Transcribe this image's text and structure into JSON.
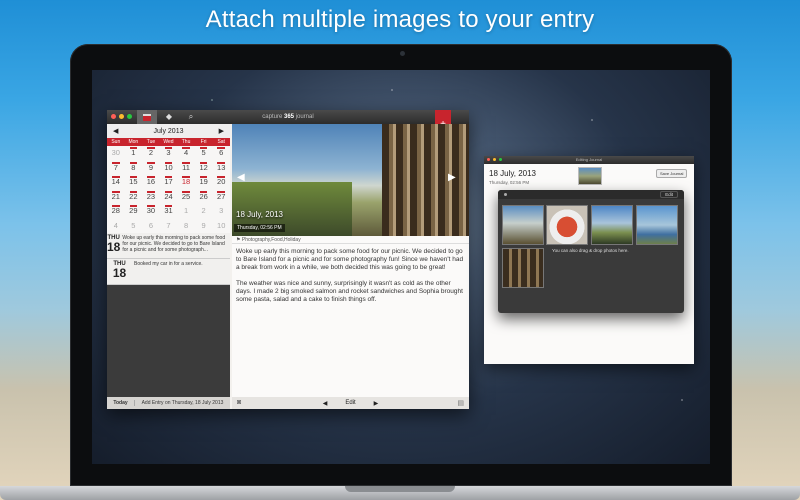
{
  "headline": "Attach multiple images to your entry",
  "main_window": {
    "title_prefix": "capture",
    "title_bold": "365",
    "title_suffix": "journal",
    "toolbar": {
      "calendar_icon": "calendar-icon",
      "tag_icon": "tag-icon",
      "search_icon": "search-icon"
    },
    "ribbon_symbol": "+",
    "calendar": {
      "prev": "◀",
      "next": "▶",
      "month": "July 2013",
      "weekdays": [
        "Sun",
        "Mon",
        "Tue",
        "Wed",
        "Thu",
        "Fri",
        "Sat"
      ],
      "days": [
        {
          "n": "30",
          "dim": true
        },
        {
          "n": "1"
        },
        {
          "n": "2"
        },
        {
          "n": "3"
        },
        {
          "n": "4"
        },
        {
          "n": "5"
        },
        {
          "n": "6"
        },
        {
          "n": "7"
        },
        {
          "n": "8"
        },
        {
          "n": "9"
        },
        {
          "n": "10"
        },
        {
          "n": "11"
        },
        {
          "n": "12"
        },
        {
          "n": "13"
        },
        {
          "n": "14"
        },
        {
          "n": "15"
        },
        {
          "n": "16"
        },
        {
          "n": "17"
        },
        {
          "n": "18",
          "red": true
        },
        {
          "n": "19"
        },
        {
          "n": "20"
        },
        {
          "n": "21"
        },
        {
          "n": "22"
        },
        {
          "n": "23"
        },
        {
          "n": "24"
        },
        {
          "n": "25"
        },
        {
          "n": "26"
        },
        {
          "n": "27"
        },
        {
          "n": "28"
        },
        {
          "n": "29"
        },
        {
          "n": "30"
        },
        {
          "n": "31"
        },
        {
          "n": "1",
          "dim": true
        },
        {
          "n": "2",
          "dim": true
        },
        {
          "n": "3",
          "dim": true
        },
        {
          "n": "4",
          "dim": true
        },
        {
          "n": "5",
          "dim": true
        },
        {
          "n": "6",
          "dim": true
        },
        {
          "n": "7",
          "dim": true
        },
        {
          "n": "8",
          "dim": true
        },
        {
          "n": "9",
          "dim": true
        },
        {
          "n": "10",
          "dim": true
        }
      ],
      "marked": [
        "1",
        "2",
        "3",
        "4",
        "5",
        "6",
        "7",
        "8",
        "9",
        "10",
        "11",
        "12",
        "13",
        "14",
        "15",
        "16",
        "17",
        "18",
        "19",
        "20",
        "21",
        "22",
        "23",
        "24",
        "25",
        "26",
        "27",
        "28",
        "29",
        "30",
        "31"
      ]
    },
    "entries": [
      {
        "day": "THU",
        "date": "18",
        "text": "Woke up early this morning to pack some food for our picnic. We decided to go to Bare Island for a picnic and for some photograph..."
      },
      {
        "day": "THU",
        "date": "18",
        "text": "Booked my car in for a service."
      }
    ],
    "footer": {
      "today": "Today",
      "add": "Add Entry on Thursday, 18 July 2013"
    },
    "detail": {
      "date_large": "18 July, 2013",
      "date_small": "Thursday, 02:56 PM",
      "tags": "Photography,Food,Holiday",
      "paragraph1": "Woke up early this morning to pack some food for our picnic. We decided to go to Bare Island for a picnic and for some photography fun! Since we haven't had a break from work in a while, we both decided this was going to be great!",
      "paragraph2": "The weather was nice and sunny, surprisingly it wasn't as cold as the other days. I made 2 big smoked salmon and rocket sandwiches and Sophia brought some pasta, salad and a cake to finish things off.",
      "photo_prev": "◀",
      "photo_next": "▶",
      "footer_prev": "◀",
      "footer_edit": "Edit",
      "footer_next": "▶"
    }
  },
  "edit_window": {
    "title": "Editing Journal",
    "date": "18 July, 2013",
    "time": "Thursday, 02:56 PM",
    "save": "Save Journal",
    "popup_edit": "Edit",
    "popup_hint": "You can also drag & drop photos here."
  }
}
